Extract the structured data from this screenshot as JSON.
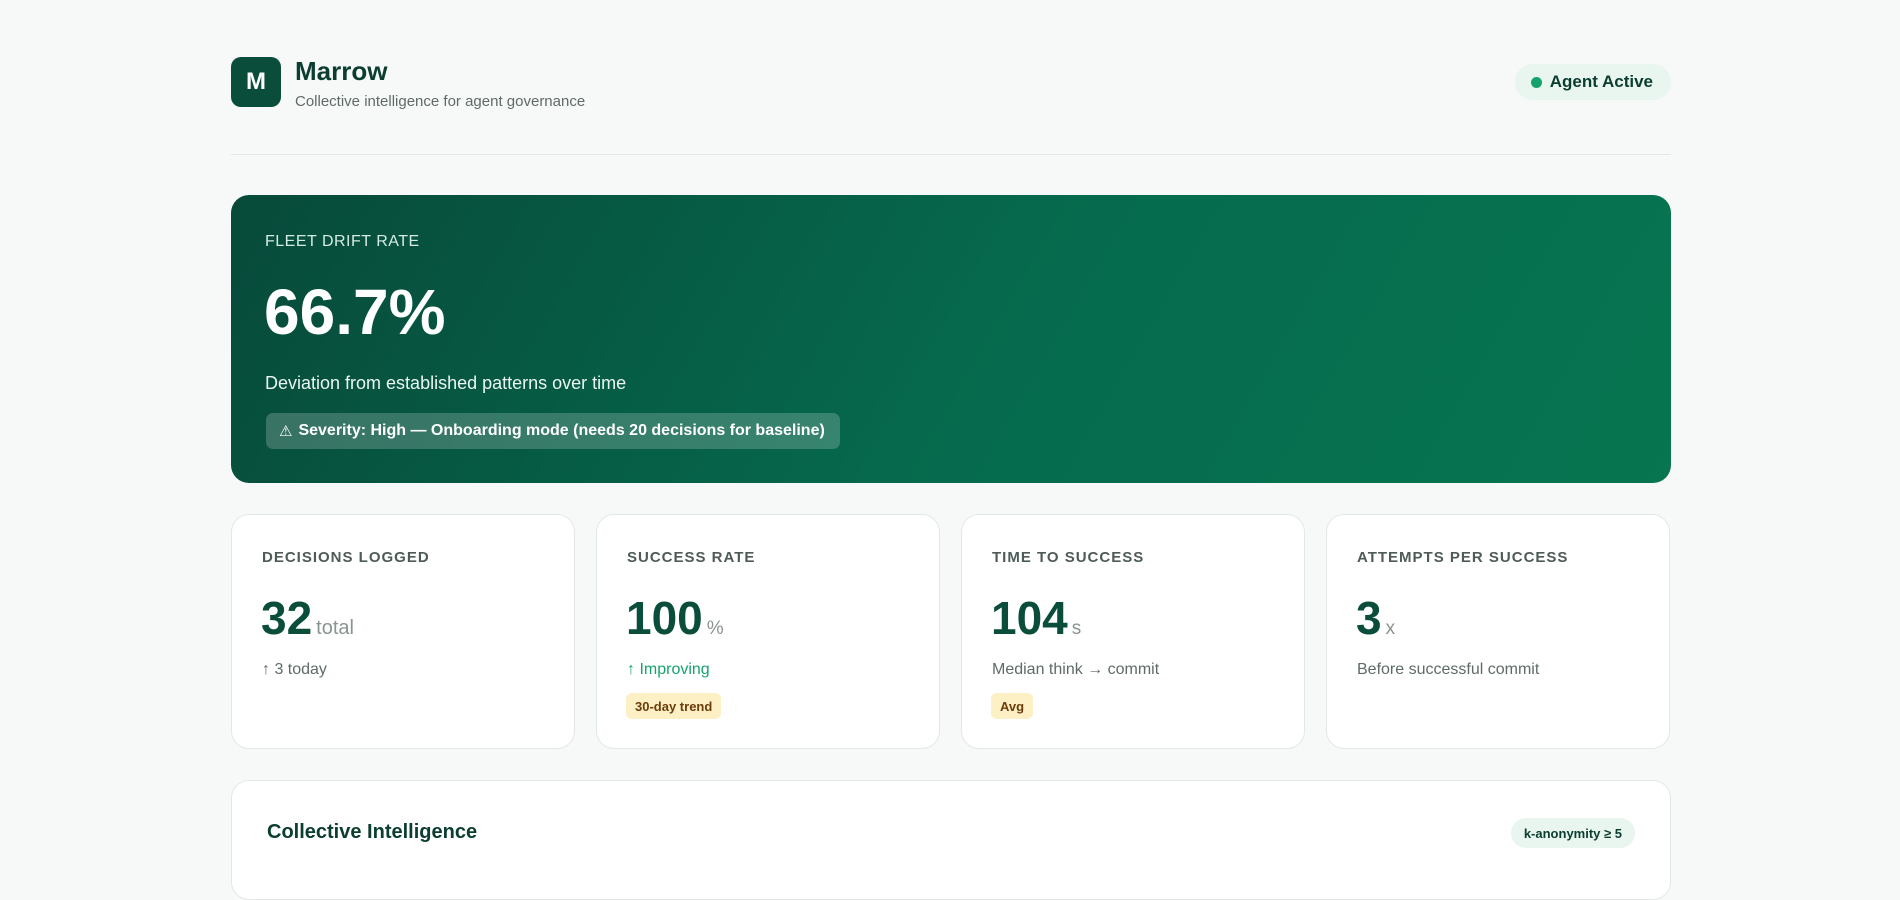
{
  "header": {
    "logo_letter": "M",
    "title": "Marrow",
    "subtitle": "Collective intelligence for agent governance",
    "status": {
      "label": "Agent Active",
      "color": "#16a36b"
    }
  },
  "hero": {
    "label": "FLEET DRIFT RATE",
    "value": "66.7%",
    "description": "Deviation from established patterns over time",
    "badge_icon": "⚠",
    "badge_text": "Severity: High — Onboarding mode (needs 20 decisions for baseline)"
  },
  "cards": [
    {
      "label": "DECISIONS LOGGED",
      "value": "32",
      "unit": "total",
      "sub": "↑ 3 today"
    },
    {
      "label": "SUCCESS RATE",
      "value": "100",
      "unit": "%",
      "sub": "↑ Improving",
      "tag": "30-day trend"
    },
    {
      "label": "TIME TO SUCCESS",
      "value": "104",
      "unit": "s",
      "sub": "Median think → commit",
      "tag": "Avg"
    },
    {
      "label": "ATTEMPTS PER SUCCESS",
      "value": "3",
      "unit": "x",
      "sub": "Before successful commit"
    }
  ],
  "panel": {
    "title": "Collective Intelligence",
    "pill": "k-anonymity ≥ 5"
  },
  "colors": {
    "brand": "#0b4d3b",
    "accent_green": "#16a36b",
    "tag_bg": "#fdf0c4"
  }
}
